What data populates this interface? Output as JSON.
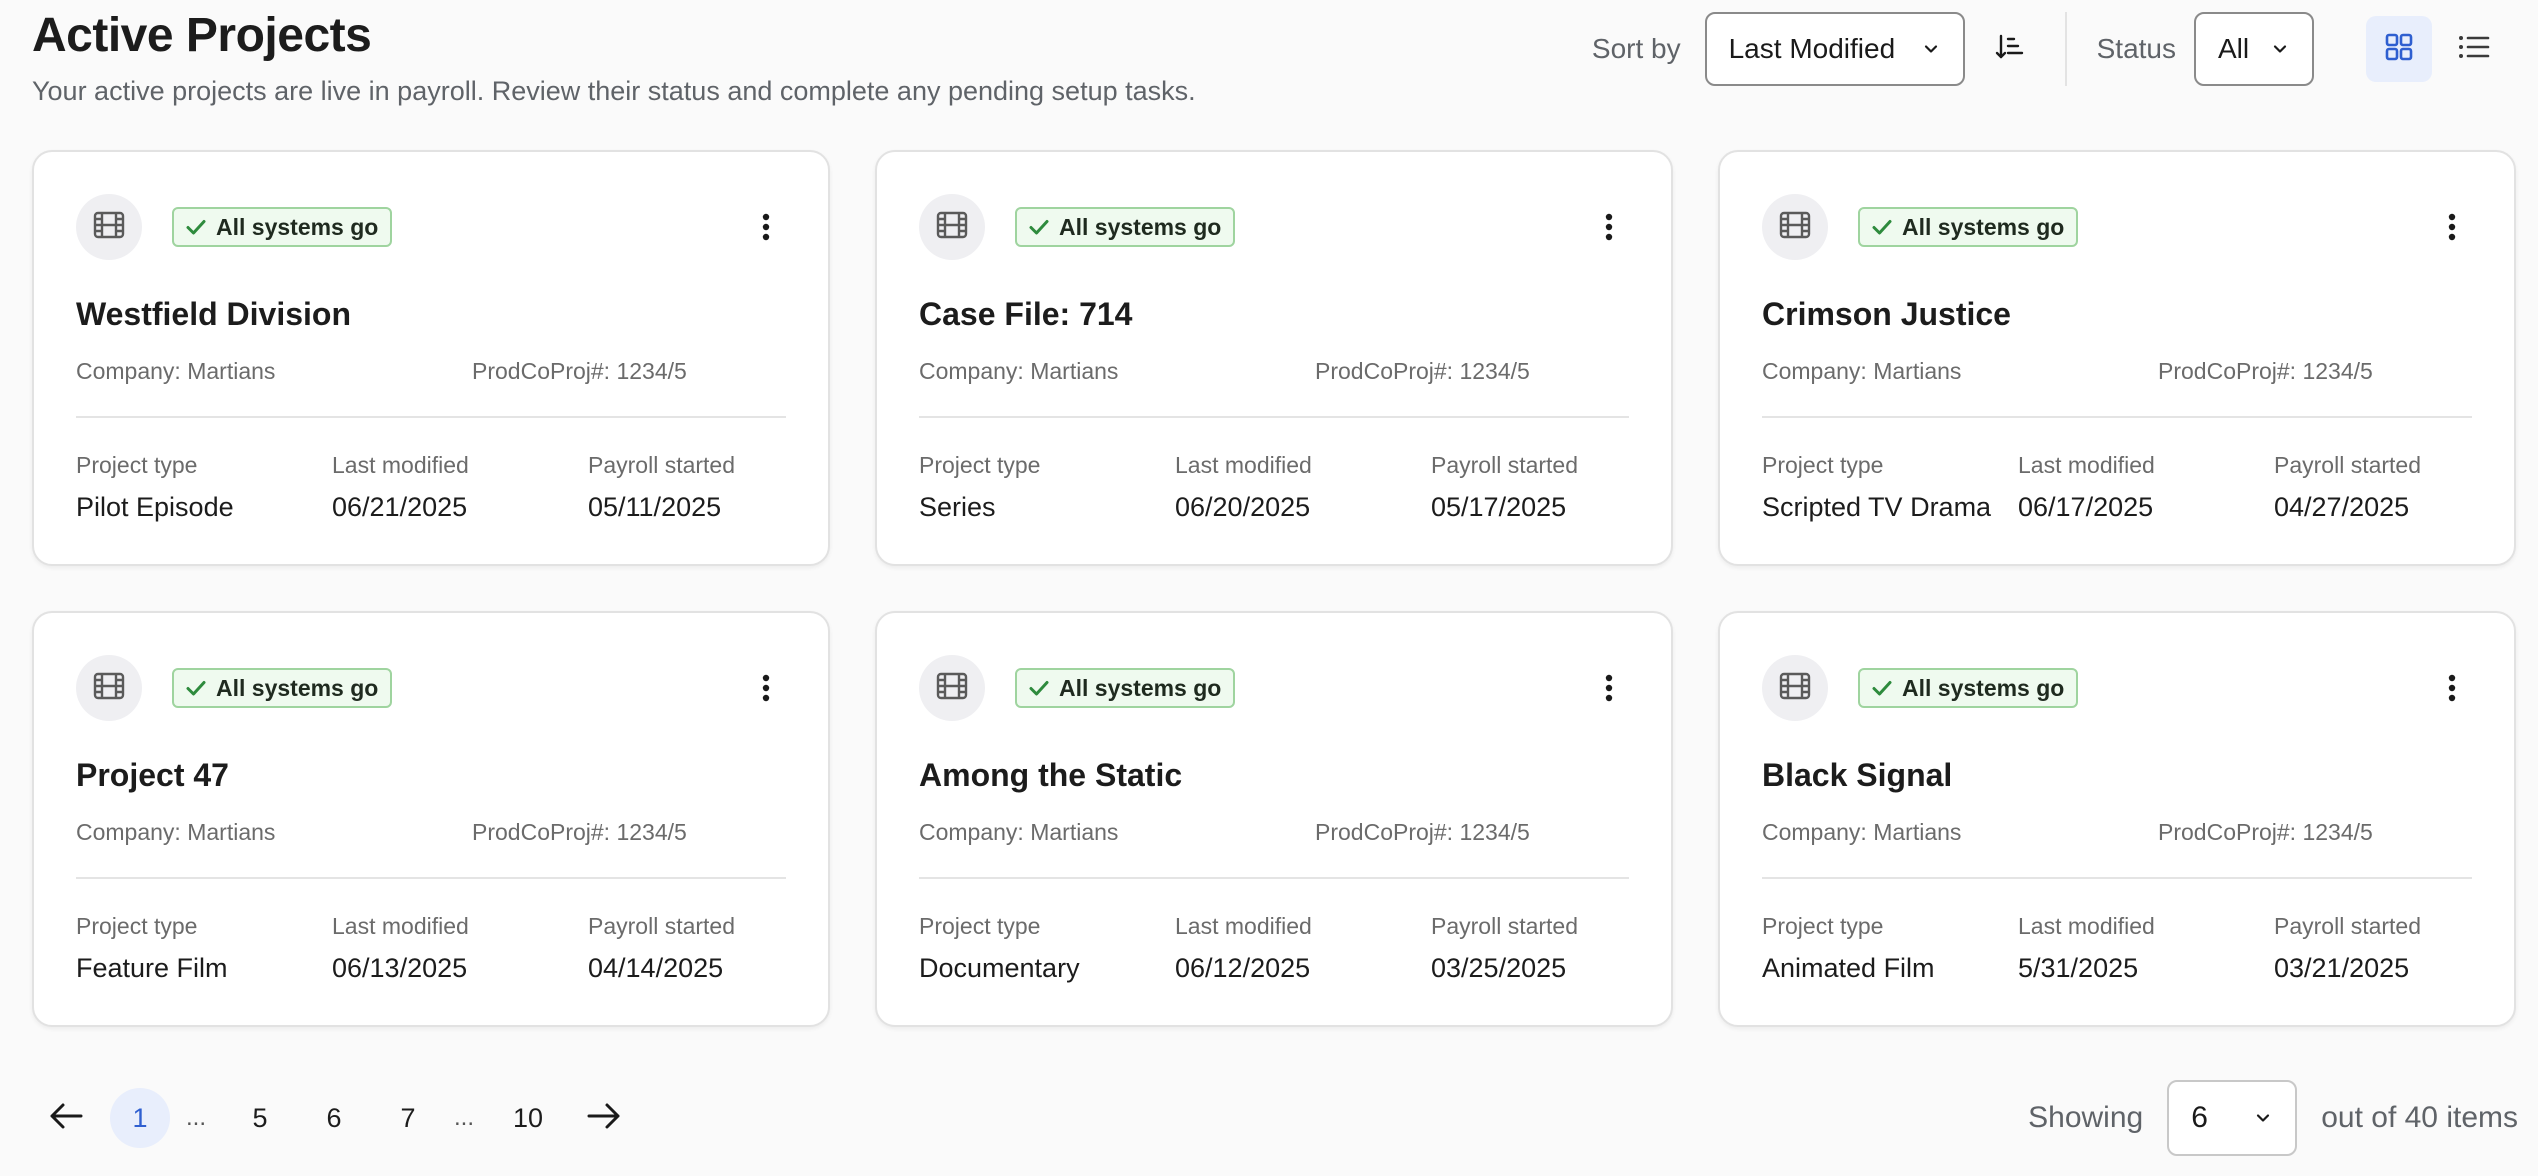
{
  "header": {
    "title": "Active Projects",
    "subtitle": "Your active projects are live in payroll. Review their status and complete any pending setup tasks."
  },
  "controls": {
    "sort_label": "Sort by",
    "sort_value": "Last Modified",
    "status_label": "Status",
    "status_value": "All",
    "active_view": "grid"
  },
  "labels": {
    "project_type": "Project type",
    "last_modified": "Last modified",
    "payroll_started": "Payroll started"
  },
  "projects": [
    {
      "title": "Westfield Division",
      "status": "All systems go",
      "company": "Company: Martians",
      "prodco": "ProdCoProj#: 1234/5",
      "type": "Pilot Episode",
      "last_modified": "06/21/2025",
      "payroll_started": "05/11/2025"
    },
    {
      "title": "Case File: 714",
      "status": "All systems go",
      "company": "Company: Martians",
      "prodco": "ProdCoProj#: 1234/5",
      "type": "Series",
      "last_modified": "06/20/2025",
      "payroll_started": "05/17/2025"
    },
    {
      "title": "Crimson Justice",
      "status": "All systems go",
      "company": "Company: Martians",
      "prodco": "ProdCoProj#: 1234/5",
      "type": "Scripted TV Drama",
      "last_modified": "06/17/2025",
      "payroll_started": "04/27/2025"
    },
    {
      "title": "Project 47",
      "status": "All systems go",
      "company": "Company: Martians",
      "prodco": "ProdCoProj#: 1234/5",
      "type": "Feature Film",
      "last_modified": "06/13/2025",
      "payroll_started": "04/14/2025"
    },
    {
      "title": "Among the Static",
      "status": "All systems go",
      "company": "Company: Martians",
      "prodco": "ProdCoProj#: 1234/5",
      "type": "Documentary",
      "last_modified": "06/12/2025",
      "payroll_started": "03/25/2025"
    },
    {
      "title": "Black Signal",
      "status": "All systems go",
      "company": "Company: Martians",
      "prodco": "ProdCoProj#: 1234/5",
      "type": "Animated Film",
      "last_modified": "5/31/2025",
      "payroll_started": "03/21/2025"
    }
  ],
  "pagination": {
    "pages": [
      "1",
      "5",
      "6",
      "7",
      "10"
    ],
    "ellipsis": "...",
    "current": "1"
  },
  "footer": {
    "showing_label": "Showing",
    "page_size": "6",
    "total_text": "out of 40 items"
  },
  "colors": {
    "accent": "#2f5fd0",
    "badge_border": "#9fd49f",
    "badge_check": "#2e8b3d"
  },
  "icons": {
    "project": "film-icon",
    "status_ok": "check-icon",
    "menu": "kebab-menu-icon",
    "sort_direction": "sort-descending-icon",
    "grid_view": "grid-view-icon",
    "list_view": "list-view-icon",
    "prev": "arrow-left-icon",
    "next": "arrow-right-icon",
    "dropdown": "chevron-down-icon"
  }
}
